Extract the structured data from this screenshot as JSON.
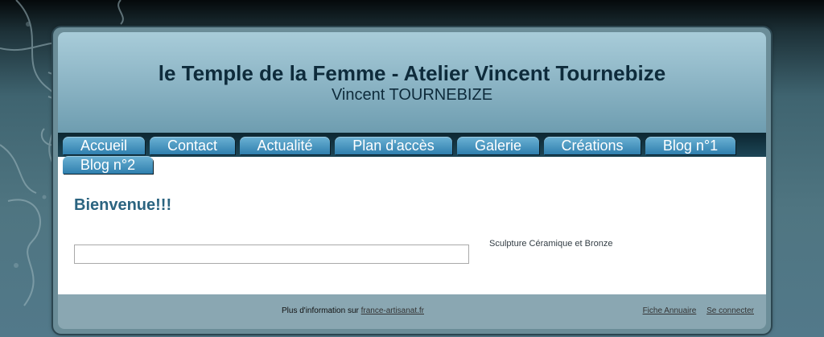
{
  "header": {
    "title": "le Temple de la Femme - Atelier Vincent Tournebize",
    "subtitle": "Vincent TOURNEBIZE"
  },
  "nav": {
    "items": [
      {
        "label": "Accueil"
      },
      {
        "label": "Contact"
      },
      {
        "label": "Actualité"
      },
      {
        "label": "Plan d'accès"
      },
      {
        "label": "Galerie"
      },
      {
        "label": "Créations"
      },
      {
        "label": "Blog n°1"
      },
      {
        "label": "Blog n°2"
      }
    ]
  },
  "main": {
    "heading": "Bienvenue!!!",
    "input_value": "",
    "side_text": "Sculpture Céramique et Bronze"
  },
  "footer": {
    "info_prefix": "Plus d'information sur",
    "info_link": "france-artisanat.fr",
    "annuaire_link": "Fiche Annuaire",
    "login_link": "Se connecter"
  },
  "colors": {
    "page_background": "#3f6470",
    "header_light": "#a8ccd9",
    "nav_tab": "#3a8bb8",
    "heading": "#2b6480",
    "footer": "#8aa7b2"
  }
}
